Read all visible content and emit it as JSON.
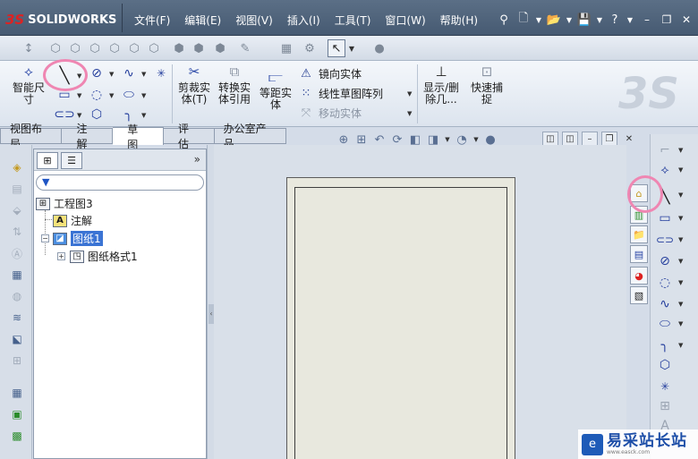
{
  "app": {
    "logo_text": "SOLIDWORKS",
    "logo_mark": "3S"
  },
  "menu": {
    "items": [
      "文件(F)",
      "编辑(E)",
      "视图(V)",
      "插入(I)",
      "工具(T)",
      "窗口(W)",
      "帮助(H)"
    ]
  },
  "ribbon": {
    "smart_dim_label": "智能尺寸",
    "trim_label": "剪裁实体(T)",
    "convert_label": "转换实体引用",
    "offset_label": "等距实体",
    "mirror_label": "镜向实体",
    "linear_pattern_label": "线性草图阵列",
    "move_label": "移动实体",
    "show_delete_label": "显示/删除几...",
    "quick_snap_label": "快速捕捉"
  },
  "tabs": [
    {
      "label": "视图布局",
      "active": false
    },
    {
      "label": "注解",
      "active": false
    },
    {
      "label": "草图",
      "active": true
    },
    {
      "label": "评估",
      "active": false
    },
    {
      "label": "办公室产品",
      "active": false
    }
  ],
  "featuretree": {
    "root": "工程图3",
    "annotations": "注解",
    "sheet": "图纸1",
    "sheet_format": "图纸格式1",
    "more": "»"
  },
  "watermark": {
    "main": "易采站长站",
    "sub": "www.easck.com"
  },
  "colors": {
    "highlight_circle": "#ef86b2",
    "selection": "#3b74d4",
    "menubar": "#4f6379"
  }
}
